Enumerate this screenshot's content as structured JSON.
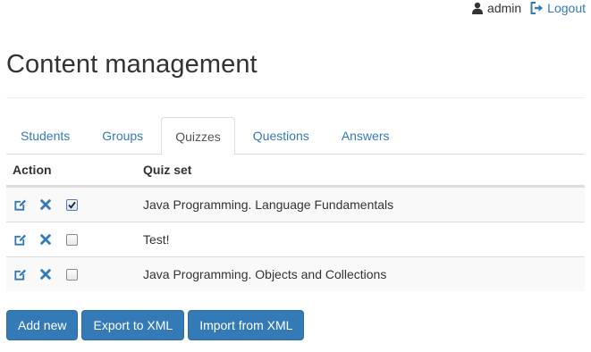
{
  "header": {
    "username": "admin",
    "logout_label": "Logout"
  },
  "page_title": "Content management",
  "tabs": [
    {
      "label": "Students",
      "active": false
    },
    {
      "label": "Groups",
      "active": false
    },
    {
      "label": "Quizzes",
      "active": true
    },
    {
      "label": "Questions",
      "active": false
    },
    {
      "label": "Answers",
      "active": false
    }
  ],
  "table": {
    "headers": {
      "action": "Action",
      "quiz_set": "Quiz set"
    },
    "rows": [
      {
        "quiz_set": "Java Programming. Language Fundamentals",
        "checked": true
      },
      {
        "quiz_set": "Test!",
        "checked": false
      },
      {
        "quiz_set": "Java Programming. Objects and Collections",
        "checked": false
      }
    ]
  },
  "buttons": {
    "add_new": "Add new",
    "export_xml": "Export to XML",
    "import_xml": "Import from XML"
  },
  "colors": {
    "primary": "#337ab7",
    "text": "#333333",
    "border": "#dddddd"
  },
  "icons": {
    "user": "user-icon",
    "logout": "logout-icon",
    "edit": "edit-icon",
    "delete": "delete-icon",
    "checkbox": "checkbox"
  }
}
